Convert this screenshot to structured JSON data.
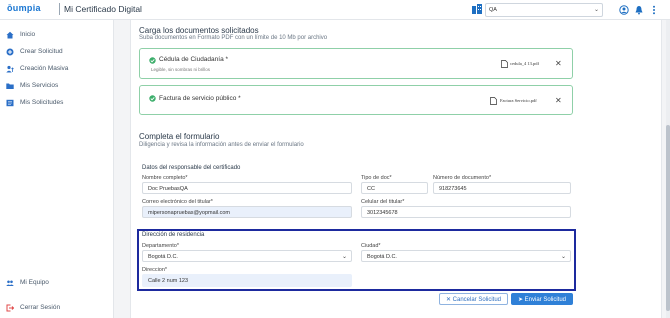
{
  "header": {
    "logo_text": "ōumpia",
    "app_title": "Mi Certificado Digital",
    "environment": "QA"
  },
  "sidebar": {
    "items": [
      {
        "label": "Inicio",
        "icon": "home-icon"
      },
      {
        "label": "Crear Solicitud",
        "icon": "plus-icon"
      },
      {
        "label": "Creación Masiva",
        "icon": "person-upload-icon"
      },
      {
        "label": "Mis Servicios",
        "icon": "folder-icon"
      },
      {
        "label": "Mis Solicitudes",
        "icon": "list-icon"
      }
    ],
    "team_label": "Mi Equipo",
    "logout_label": "Cerrar Sesión"
  },
  "documents": {
    "title": "Carga los documentos solicitados",
    "subtitle": "Suba documentos en Formato PDF con un límite de 10 Mb por archivo",
    "items": [
      {
        "title": "Cédula de Ciudadanía *",
        "hint": "Legible, sin sombras ni brillos",
        "file": "cedula_4 13.pdf"
      },
      {
        "title": "Factura de servicio público *",
        "hint": "",
        "file": "Factura Servicio.pdf"
      }
    ]
  },
  "form": {
    "title": "Completa el formulario",
    "subtitle": "Diligencia y revisa la información antes de enviar el formulario",
    "responsible_title": "Datos del responsable del certificado",
    "full_name": {
      "label": "Nombre completo*",
      "value": "Doc PruebasQA"
    },
    "doc_type": {
      "label": "Tipo de doc*",
      "value": "CC"
    },
    "doc_number": {
      "label": "Número de documento*",
      "value": "918273645"
    },
    "email": {
      "label": "Correo electrónico del titular*",
      "value": "mipersonapruebas@yopmail.com"
    },
    "phone": {
      "label": "Celular del titular*",
      "value": "3012345678"
    },
    "address_title": "Dirección de residencia",
    "department": {
      "label": "Departamento*",
      "value": "Bogotá D.C."
    },
    "city": {
      "label": "Ciudad*",
      "value": "Bogotá D.C."
    },
    "address": {
      "label": "Direccion*",
      "value": "Calle 2 num 123"
    }
  },
  "actions": {
    "cancel_label": "✕ Cancelar Solicitud",
    "send_label": "➤ Enviar Solicitud"
  },
  "colors": {
    "brand": "#1976d2",
    "success_border": "#8fd0a8",
    "highlight": "#1d2a9e",
    "primary_button": "#2f80d7"
  }
}
